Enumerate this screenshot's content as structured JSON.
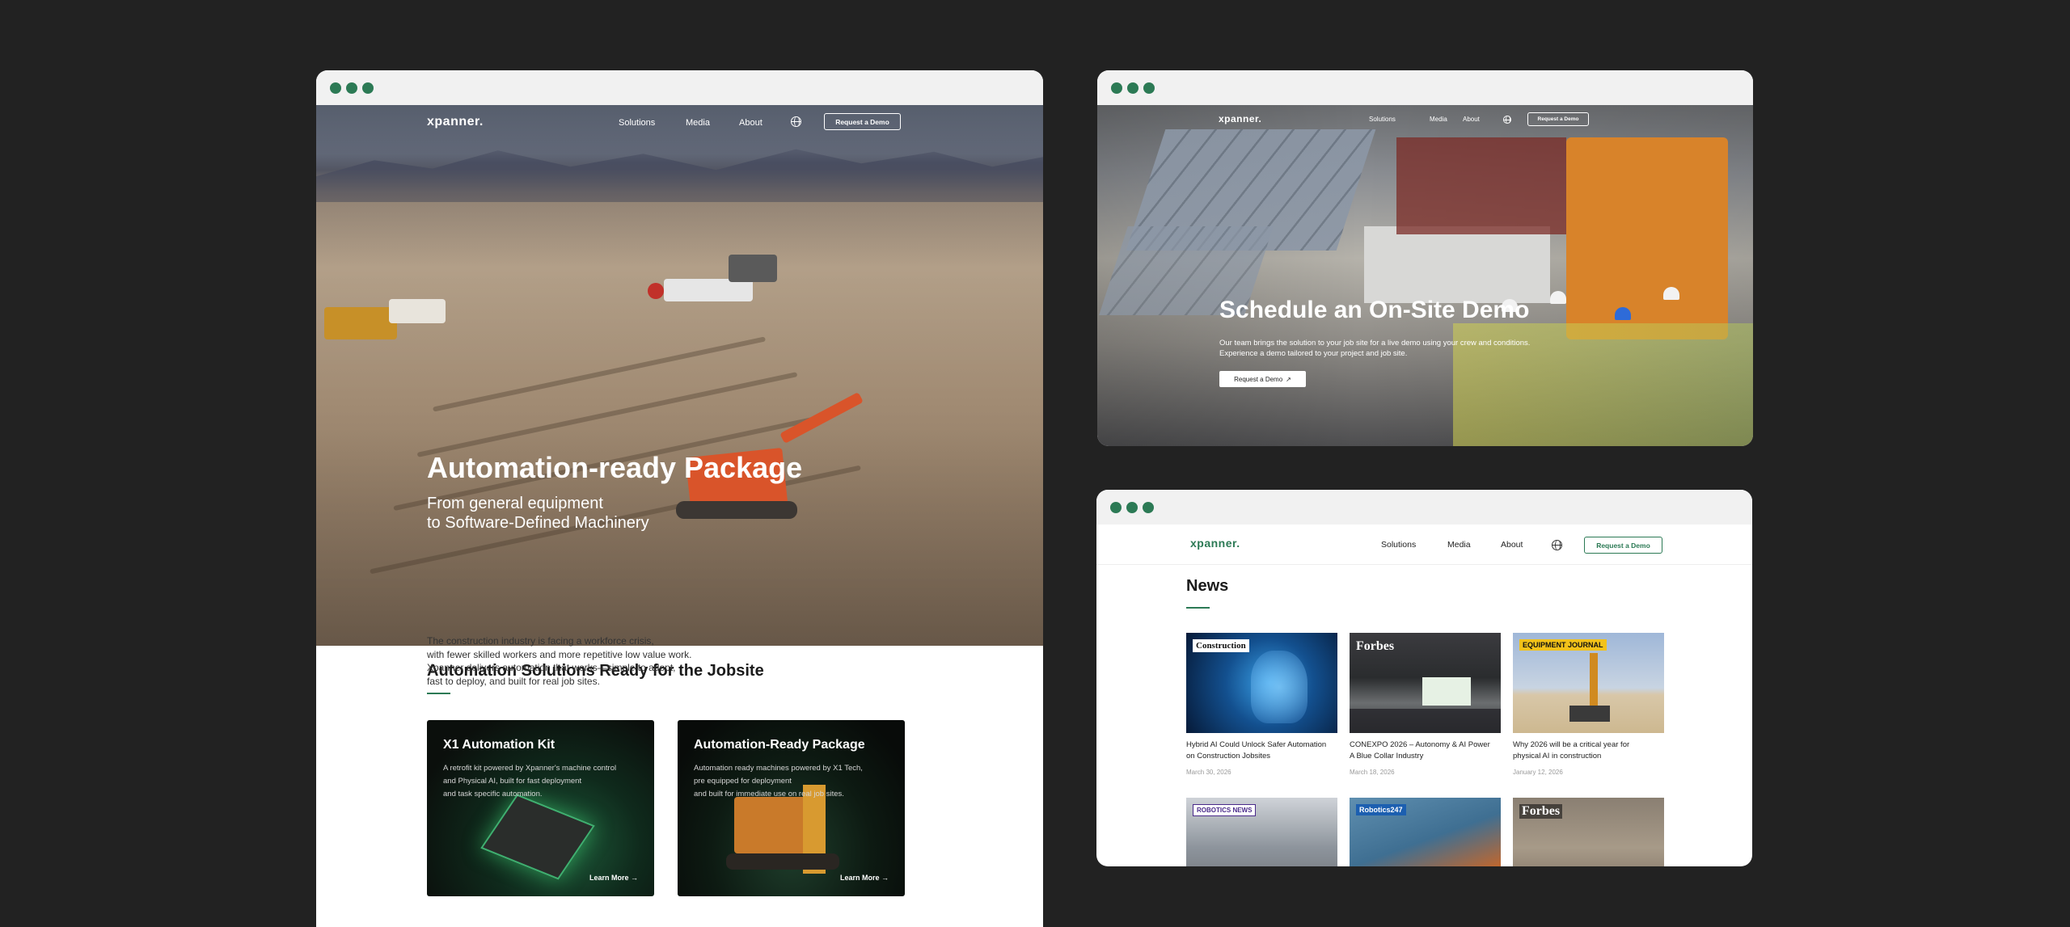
{
  "colors": {
    "background": "#222222",
    "accent": "#2c7a55",
    "card_dark": "#121212"
  },
  "window1": {
    "nav": {
      "logo": "xpanner.",
      "links": [
        "Solutions",
        "Media",
        "About"
      ],
      "cta": "Request a Demo"
    },
    "hero": {
      "title": "Automation-ready Package",
      "subtitle_line1": "From general equipment",
      "subtitle_line2": "to Software-Defined Machinery"
    },
    "section": {
      "title": "Automation Solutions Ready for the Jobsite",
      "body": [
        "The construction industry is facing a workforce crisis,",
        "with fewer skilled workers and more repetitive low value work.",
        "Xpanner delivers automation that works—simple to adopt,",
        "fast to deploy, and built for real job sites."
      ]
    },
    "cards": [
      {
        "title": "X1 Automation Kit",
        "body": [
          "A retrofit kit powered by Xpanner's machine control",
          "and Physical AI, built for fast deployment",
          "and task specific automation."
        ],
        "link": "Learn More →"
      },
      {
        "title": "Automation-Ready Package",
        "body": [
          "Automation ready machines powered by X1 Tech,",
          "pre equipped for deployment",
          "and built for immediate use on real job sites."
        ],
        "link": "Learn More →"
      }
    ]
  },
  "window2": {
    "nav": {
      "logo": "xpanner.",
      "links": [
        "Solutions",
        "Media",
        "About"
      ],
      "cta": "Request a Demo"
    },
    "hero": {
      "title": "Schedule an On-Site Demo",
      "body_line1": "Our team brings the solution to your job site for a live demo using your crew and conditions.",
      "body_line2": "Experience a demo tailored to your project and job site.",
      "button": "Request a Demo"
    }
  },
  "window3": {
    "nav": {
      "logo": "xpanner.",
      "links": [
        "Solutions",
        "Media",
        "About"
      ],
      "cta": "Request a Demo"
    },
    "title": "News",
    "articles": [
      {
        "source": "Construction",
        "caption_line1": "Hybrid AI Could Unlock Safer Automation",
        "caption_line2": "on Construction Jobsites",
        "date": "March 30, 2026"
      },
      {
        "source": "Forbes",
        "caption_line1": "CONEXPO 2026 – Autonomy & AI Power",
        "caption_line2": "A Blue Collar Industry",
        "date": "March 18, 2026"
      },
      {
        "source": "EQUIPMENT JOURNAL",
        "caption_line1": "Why 2026 will be a critical year for",
        "caption_line2": "physical AI in construction",
        "date": "January 12, 2026"
      },
      {
        "source": "ROBOTICS NEWS"
      },
      {
        "source": "Robotics247"
      },
      {
        "source": "Forbes"
      }
    ]
  }
}
